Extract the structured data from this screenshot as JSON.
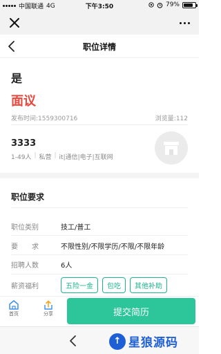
{
  "status_bar": {
    "carrier": "中国联通",
    "network": "4G",
    "time": "下午3:50",
    "battery": "79%",
    "battery_level": 0.79
  },
  "nav": {
    "title": "职位详情"
  },
  "job": {
    "title": "是",
    "salary": "面议",
    "publish_time": "发布时间:1559300716",
    "views": "浏览量:112"
  },
  "company": {
    "name": "3333",
    "size": "1-49人",
    "nature": "私营",
    "industry": "it|通信|电子|互联网"
  },
  "requirements": {
    "section_title": "职位要求",
    "rows": [
      {
        "label": "职位类别",
        "value": "技工/普工"
      },
      {
        "label": "要　　求",
        "value": "不限性别/不限学历/不限/不限年龄"
      },
      {
        "label": "招聘人数",
        "value": "6人"
      }
    ],
    "benefits_label": "薪资福利",
    "benefits": [
      "五险一金",
      "包吃",
      "其他补助"
    ]
  },
  "bottom_bar": {
    "home_label": "首页",
    "share_label": "分享",
    "submit_label": "提交简历"
  },
  "watermark": {
    "logo_char": "↑",
    "text": "星狼源码"
  },
  "colors": {
    "accent_green": "#2dc59a",
    "salary_red": "#e9463c",
    "icon_blue": "#3b8ef0",
    "share_orange": "#f5a623",
    "watermark_blue": "#1f5fd6"
  }
}
